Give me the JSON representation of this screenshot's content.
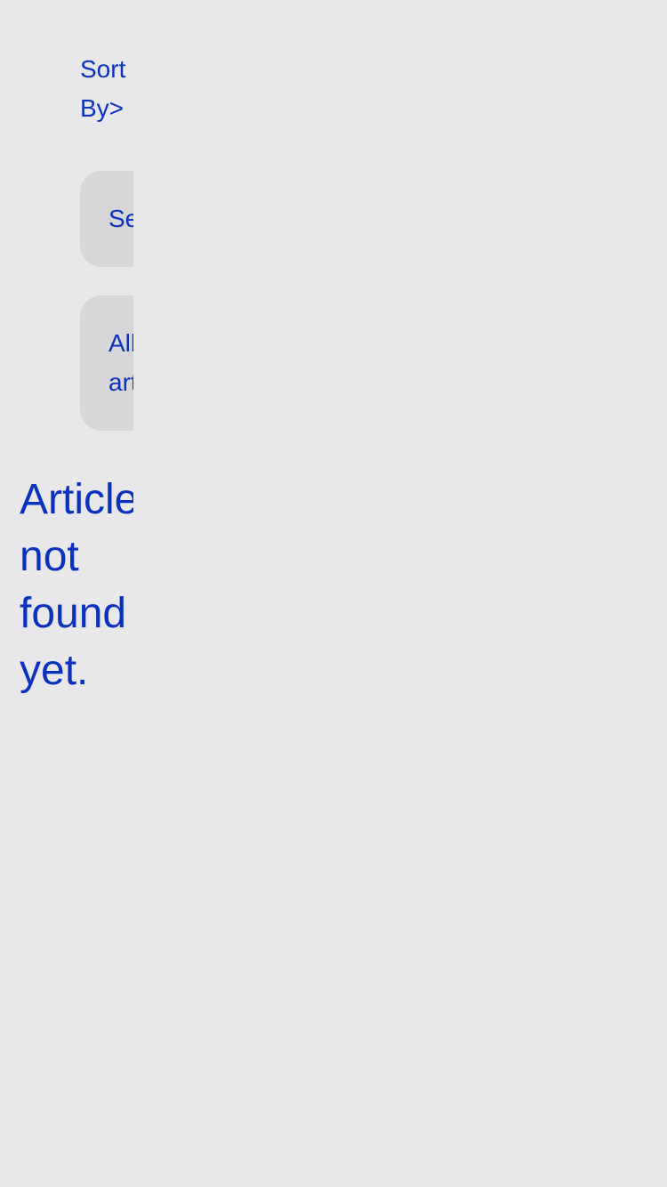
{
  "sort": {
    "label": "Sort\nBy>"
  },
  "filters": {
    "search_label": "Se",
    "all_articles_label": "All\nart"
  },
  "empty_state": {
    "message": "Article\nnot\nfound\nyet."
  },
  "colors": {
    "background": "#e8e8ea",
    "chip_background": "#d7d7d9",
    "text": "#0a32be"
  }
}
